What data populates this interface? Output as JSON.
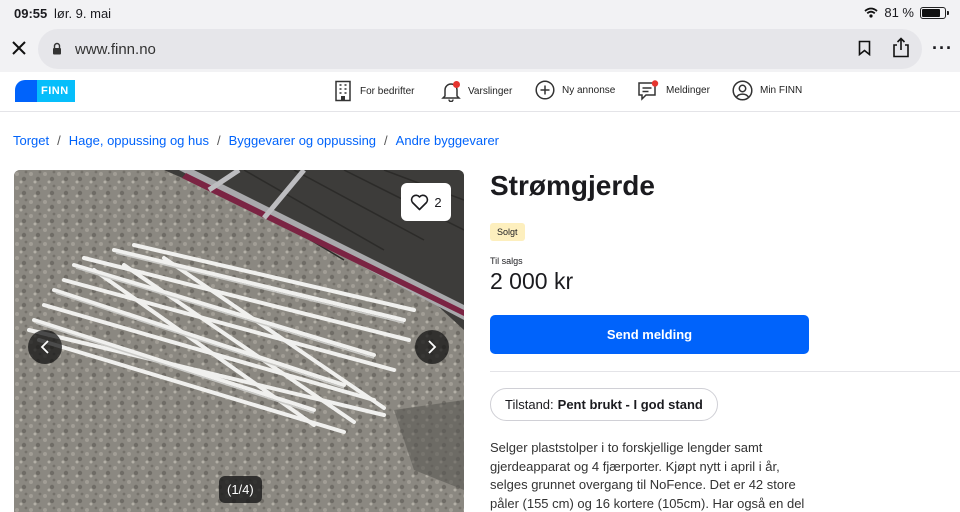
{
  "status_bar": {
    "time": "09:55",
    "date": "lør. 9. mai",
    "battery": "81 %",
    "battery_level": 0.81
  },
  "browser": {
    "url": "www.finn.no"
  },
  "header": {
    "logo_text": "FINN",
    "nav": [
      {
        "label": "For bedrifter",
        "icon": "building-icon"
      },
      {
        "label": "Varslinger",
        "icon": "bell-icon"
      },
      {
        "label": "Ny annonse",
        "icon": "plus-circle-icon"
      },
      {
        "label": "Meldinger",
        "icon": "chat-icon"
      },
      {
        "label": "Min FINN",
        "icon": "user-icon"
      }
    ]
  },
  "breadcrumbs": [
    "Torget",
    "Hage, oppussing og hus",
    "Byggevarer og oppussing",
    "Andre byggevarer"
  ],
  "gallery": {
    "favorites": "2",
    "counter": "(1/4)"
  },
  "listing": {
    "title": "Strømgjerde",
    "status": "Solgt",
    "sale_type": "Til salgs",
    "price": "2 000 kr",
    "send_button": "Send melding",
    "condition_label": "Tilstand:",
    "condition_value": "Pent brukt - I god stand",
    "description": "Selger plaststolper i to forskjellige lengder samt gjerdeapparat og 4 fjærporter. Kjøpt nytt i april i år, selges grunnet overgang til NoFence. Det er 42 store påler (155 cm) og 16 kortere (105cm). Har også en del"
  },
  "colors": {
    "accent": "#0063fb",
    "logo_light": "#06befb",
    "badge": "#fdefbe"
  }
}
